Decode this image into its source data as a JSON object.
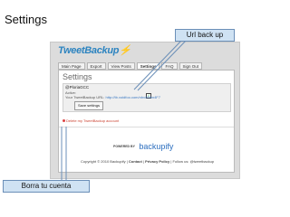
{
  "slide": {
    "title": "Settings"
  },
  "app": {
    "logo": {
      "main": "TweetBackup",
      "accent": "⚡"
    },
    "tabs": [
      "Main Page",
      "Export",
      "View Posts",
      "Settings",
      "FAQ",
      "Sign Out"
    ],
    "active_tab": "Settings",
    "page_title": "Settings",
    "account": {
      "name": "@PloriaGCC",
      "active_label": "Active:",
      "url_label": "Your TweetBackup URL:",
      "url_value": "http://tb.voidfoo.com/nbv/f/8bn4F7",
      "checked_mark": "✓"
    },
    "save_label": "Save settings",
    "delete_label": "Delete my TweetBackup account",
    "powered_by": "POWERED BY",
    "powered_brand": "backupify",
    "footer": {
      "copyright": "Copyright © 2010 Backupify",
      "contact": "Contact",
      "privacy": "Privacy Policy",
      "follow": "Follow us: @tweetbackup",
      "sep": " | "
    }
  },
  "callouts": {
    "url_back": "Url back up",
    "delete_account": "Borra tu cuenta"
  },
  "colors": {
    "callout_fill": "#cfe2f3",
    "callout_border": "#6b8fb8",
    "brand_blue": "#2d84c0"
  }
}
